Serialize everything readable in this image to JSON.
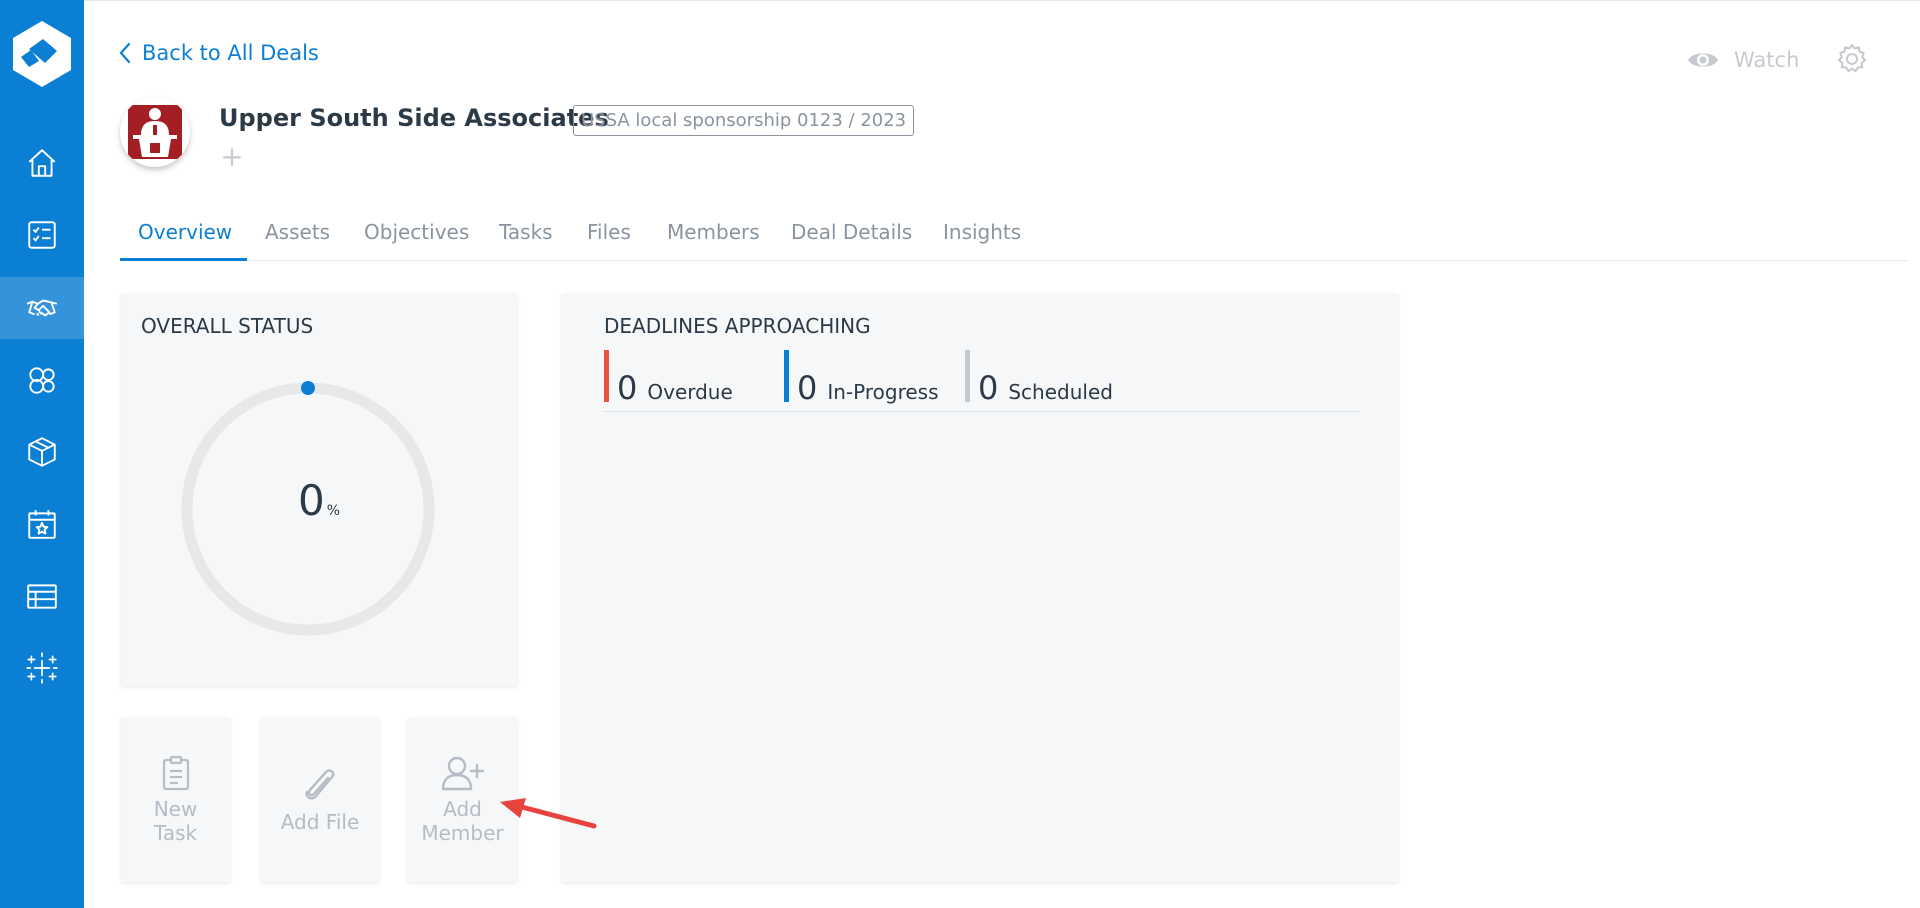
{
  "header": {
    "back_label": "Back to All Deals",
    "watch_label": "Watch"
  },
  "deal": {
    "name": "Upper South Side Associates",
    "tag": "USSA local sponsorship 0123 / 2023",
    "add_tag_symbol": "+"
  },
  "sidebar": {
    "items": [
      {
        "icon": "home-icon"
      },
      {
        "icon": "task-list-icon"
      },
      {
        "icon": "handshake-icon",
        "active": true
      },
      {
        "icon": "people-icon"
      },
      {
        "icon": "box-icon"
      },
      {
        "icon": "calendar-star-icon"
      },
      {
        "icon": "table-icon"
      },
      {
        "icon": "sparkle-icon"
      }
    ]
  },
  "tabs": [
    "Overview",
    "Assets",
    "Objectives",
    "Tasks",
    "Files",
    "Members",
    "Deal Details",
    "Insights"
  ],
  "active_tab": "Overview",
  "overall_status": {
    "title": "OVERALL STATUS",
    "value": "0",
    "unit": "%"
  },
  "deadlines": {
    "title": "DEADLINES APPROACHING",
    "items": [
      {
        "count": "0",
        "label": "Overdue",
        "color": "#e8543f"
      },
      {
        "count": "0",
        "label": "In-Progress",
        "color": "#0b7fd4"
      },
      {
        "count": "0",
        "label": "Scheduled",
        "color": "#c5c8cc"
      }
    ]
  },
  "actions": {
    "new_task_line1": "New",
    "new_task_line2": "Task",
    "add_file": "Add File",
    "add_member_line1": "Add",
    "add_member_line2": "Member"
  },
  "colors": {
    "accent": "#0b7fd4",
    "sidebar_active": "#3593dc",
    "arrow": "#e8443d"
  }
}
